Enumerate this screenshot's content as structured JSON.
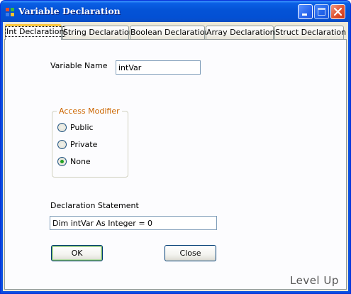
{
  "window": {
    "title": "Variable Declaration"
  },
  "tabs": [
    {
      "label": "Int Declaration",
      "active": true
    },
    {
      "label": "String Declaration",
      "active": false
    },
    {
      "label": "Boolean Declaration",
      "active": false
    },
    {
      "label": "Array Declaration",
      "active": false
    },
    {
      "label": "Struct Declaration",
      "active": false
    }
  ],
  "form": {
    "variable_name_label": "Variable Name",
    "variable_name_value": "intVar",
    "access_modifier": {
      "title": "Access Modifier",
      "options": [
        {
          "label": "Public",
          "checked": false
        },
        {
          "label": "Private",
          "checked": false
        },
        {
          "label": "None",
          "checked": true
        }
      ]
    },
    "declaration_label": "Declaration Statement",
    "declaration_value": "Dim intVar As Integer = 0",
    "ok_label": "OK",
    "close_label": "Close"
  },
  "watermark": "Level Up",
  "colors": {
    "titlebar": "#0453d6",
    "client_bg": "#ece9d8",
    "tab_accent": "#ffc83c",
    "group_title": "#cc6600",
    "radio_checked": "#21a121"
  }
}
